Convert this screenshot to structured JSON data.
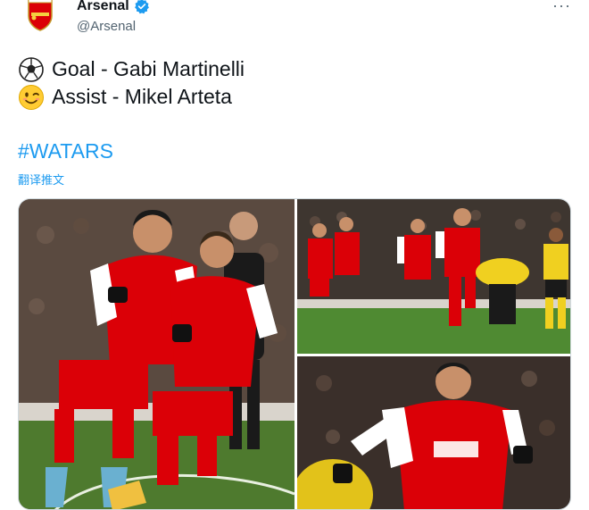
{
  "author": {
    "display_name": "Arsenal",
    "handle": "@Arsenal",
    "verified": true,
    "avatar_icon": "arsenal-crest-icon"
  },
  "more_icon": "more-icon",
  "more_label": "···",
  "tweet": {
    "lines": [
      {
        "emoji": "soccer-ball-icon",
        "text": "Goal - Gabi Martinelli"
      },
      {
        "emoji": "winking-face-icon",
        "text": "Assist - Mikel Arteta"
      }
    ],
    "hashtag": "#WATARS",
    "translate_label": "翻译推文"
  },
  "colors": {
    "link": "#1d9bf0",
    "text": "#0f1419",
    "secondary": "#536471",
    "arsenal_red": "#db0007"
  },
  "media": {
    "photos": [
      {
        "name": "photo-celebration-pair"
      },
      {
        "name": "photo-celebration-pitch"
      },
      {
        "name": "photo-celebration-closeup"
      }
    ]
  }
}
